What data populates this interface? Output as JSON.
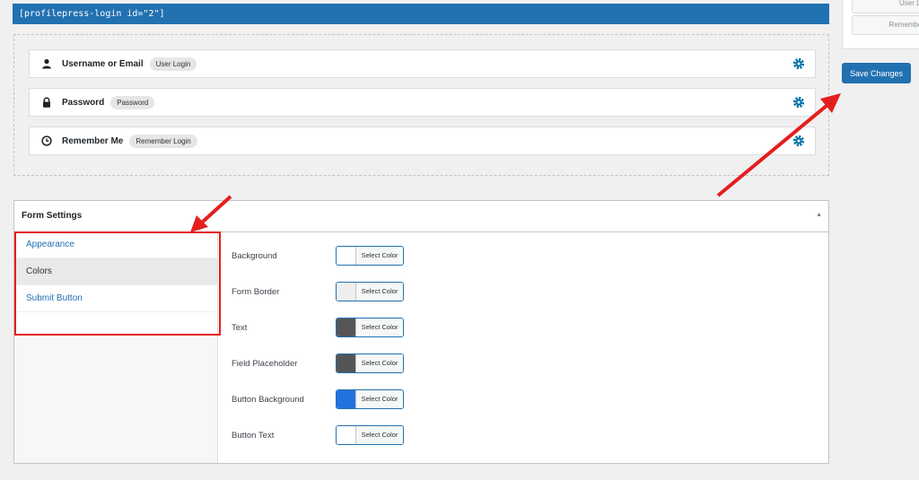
{
  "shortcode": "[profilepress-login id=\"2\"]",
  "fields": [
    {
      "label": "Username or Email",
      "badge": "User Login",
      "icon": "user-icon"
    },
    {
      "label": "Password",
      "badge": "Password",
      "icon": "lock-icon"
    },
    {
      "label": "Remember Me",
      "badge": "Remember Login",
      "icon": "clock-icon"
    }
  ],
  "side_panel": {
    "input1": "User Lo",
    "input2": "Remember"
  },
  "save_button": "Save Changes",
  "form_settings": {
    "title": "Form Settings",
    "collapse_glyph": "▲",
    "tabs": [
      "Appearance",
      "Colors",
      "Submit Button"
    ],
    "active_tab": "Colors",
    "color_options": [
      {
        "label": "Background",
        "button": "Select Color",
        "swatch": "#ffffff"
      },
      {
        "label": "Form Border",
        "button": "Select Color",
        "swatch": "#eeeeee"
      },
      {
        "label": "Text",
        "button": "Select Color",
        "swatch": "#555555"
      },
      {
        "label": "Field Placeholder",
        "button": "Select Color",
        "swatch": "#555555"
      },
      {
        "label": "Button Background",
        "button": "Select Color",
        "swatch": "#2271e0"
      },
      {
        "label": "Button Text",
        "button": "Select Color",
        "swatch": "#ffffff"
      }
    ]
  },
  "colors": {
    "accent": "#2271b1",
    "annotation": "#e41e1e",
    "gear": "#0073aa"
  }
}
